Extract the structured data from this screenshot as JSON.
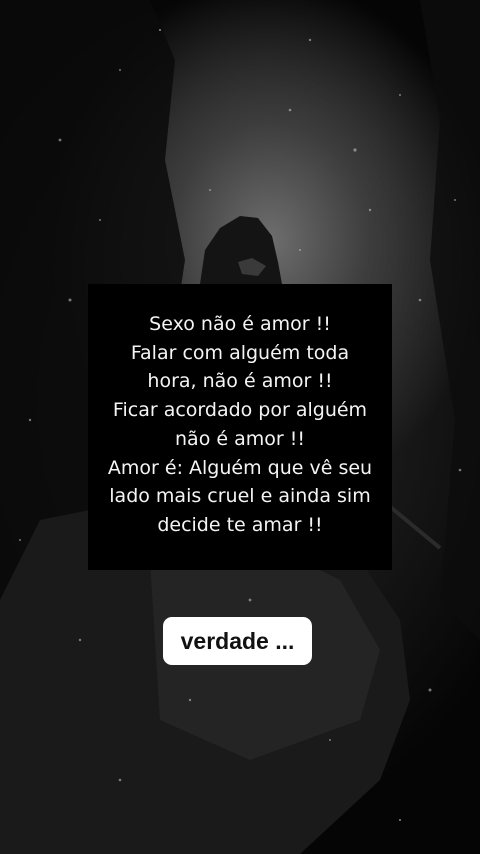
{
  "quote": {
    "lines": [
      "Sexo não é amor !!",
      "Falar com alguém toda",
      "hora, não é amor !!",
      "Ficar acordado por alguém",
      "não é amor !!",
      "Amor é: Alguém que vê seu",
      "lado mais cruel e ainda sim",
      "decide te amar !!"
    ]
  },
  "caption": {
    "label": "verdade ..."
  },
  "colors": {
    "quote_box_background": "#000000",
    "quote_text": "#f4f4f4",
    "caption_background": "#ffffff",
    "caption_text": "#111111"
  }
}
